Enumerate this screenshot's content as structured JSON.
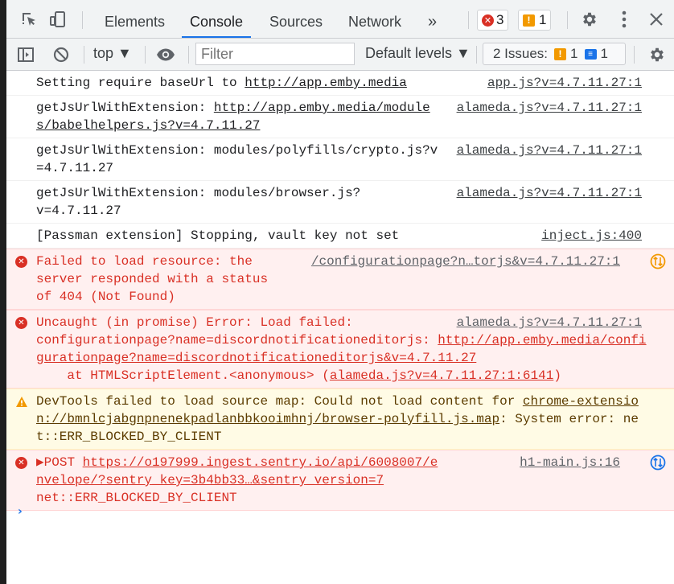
{
  "tabs": [
    {
      "label": "Elements"
    },
    {
      "label": "Console"
    },
    {
      "label": "Sources"
    },
    {
      "label": "Network"
    }
  ],
  "more_tabs": "»",
  "error_count": "3",
  "warning_count": "1",
  "toolbar": {
    "context": "top ▼",
    "filter_placeholder": "Filter",
    "levels": "Default levels ▼",
    "issues_label": "2 Issues:",
    "issues_warn": "1",
    "issues_info": "1"
  },
  "messages": [
    {
      "text_before": "Setting require baseUrl to ",
      "link": "http://app.emby.media",
      "source": "app.js?v=4.7.11.27:1"
    },
    {
      "text_before": "getJsUrlWithExtension: ",
      "link": "http://app.emby.media/modules/babelhelpers.js?v=4.7.11.27",
      "source": "alameda.js?v=4.7.11.27:1"
    },
    {
      "text": "getJsUrlWithExtension: modules/polyfills/crypto.js?v=4.7.11.27",
      "source": "alameda.js?v=4.7.11.27:1"
    },
    {
      "text": "getJsUrlWithExtension: modules/browser.js?\nv=4.7.11.27",
      "source": "alameda.js?v=4.7.11.27:1"
    },
    {
      "text": "[Passman extension] Stopping, vault key not set",
      "source": "inject.js:400"
    }
  ],
  "errors": {
    "e1": {
      "text": "Failed to load resource: the\nserver responded with a status\nof 404 (Not Found)",
      "source": "/configurationpage?n…torjs&v=4.7.11.27:1"
    },
    "e2": {
      "line1": "Uncaught (in promise) Error: Load failed:",
      "source": "alameda.js?v=4.7.11.27:1",
      "line2_before": "configurationpage?name=discordnotificationeditorjs: ",
      "link": "http://app.emby.media/configurationpage?name=discordnotificationeditorjs&v=4.7.11.27",
      "trace_before": "    at HTMLScriptElement.<anonymous> (",
      "trace_link": "alameda.js?v=4.7.11.27:1:6141",
      "trace_after": ")"
    },
    "w1": {
      "text_before": "DevTools failed to load source map: Could not load content for ",
      "link": "chrome-extension://bmnlcjabgnpnenekpadlanbbkooimhnj/browser-polyfill.js.map",
      "text_after": ": System error: net::ERR_BLOCKED_BY_CLIENT"
    },
    "e3": {
      "method": "▶POST ",
      "link": "https://o197999.ingest.sentry.io/api/6008007/envelope/?sentry_key=3b4bb33…&sentry_version=7",
      "after": "\nnet::ERR_BLOCKED_BY_CLIENT",
      "source": "h1-main.js:16"
    }
  },
  "prompt": "›"
}
